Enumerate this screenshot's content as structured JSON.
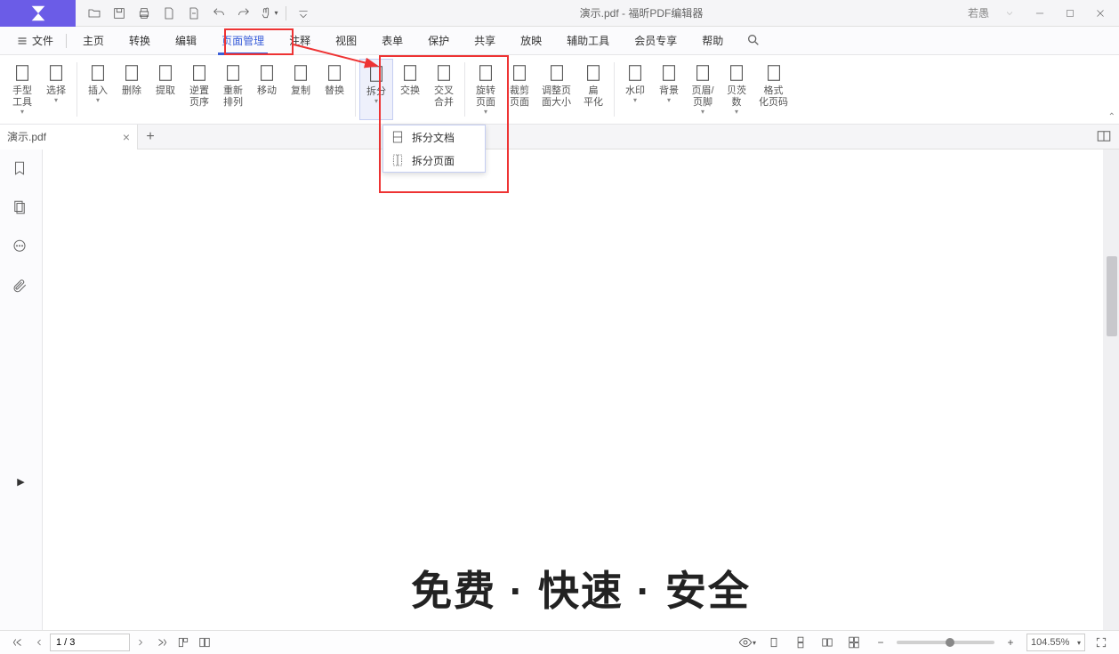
{
  "title": "演示.pdf - 福昕PDF编辑器",
  "user": "若愚",
  "menu": {
    "file": "文件",
    "items": [
      "主页",
      "转换",
      "编辑",
      "页面管理",
      "注释",
      "视图",
      "表单",
      "保护",
      "共享",
      "放映",
      "辅助工具",
      "会员专享",
      "帮助"
    ],
    "activeIndex": 3
  },
  "ribbon": [
    {
      "label": "手型\n工具",
      "dd": true
    },
    {
      "label": "选择",
      "dd": true
    },
    {
      "sep": true
    },
    {
      "label": "插入",
      "dd": true
    },
    {
      "label": "删除"
    },
    {
      "label": "提取"
    },
    {
      "label": "逆置\n页序"
    },
    {
      "label": "重新\n排列"
    },
    {
      "label": "移动"
    },
    {
      "label": "复制"
    },
    {
      "label": "替换"
    },
    {
      "sep": true
    },
    {
      "label": "拆分",
      "dd": true,
      "selected": true
    },
    {
      "label": "交换"
    },
    {
      "label": "交叉\n合并"
    },
    {
      "sep": true
    },
    {
      "label": "旋转\n页面",
      "dd": true
    },
    {
      "label": "裁剪\n页面"
    },
    {
      "label": "调整页\n面大小"
    },
    {
      "label": "扁\n平化"
    },
    {
      "sep": true
    },
    {
      "label": "水印",
      "dd": true
    },
    {
      "label": "背景",
      "dd": true
    },
    {
      "label": "页眉/\n页脚",
      "dd": true
    },
    {
      "label": "贝茨\n数",
      "dd": true
    },
    {
      "label": "格式\n化页码"
    }
  ],
  "dropdown": {
    "items": [
      "拆分文档",
      "拆分页面"
    ]
  },
  "doctab": {
    "name": "演示.pdf"
  },
  "page_content": "免费 · 快速 · 安全",
  "status": {
    "page": "1 / 3",
    "zoom": "104.55%"
  }
}
